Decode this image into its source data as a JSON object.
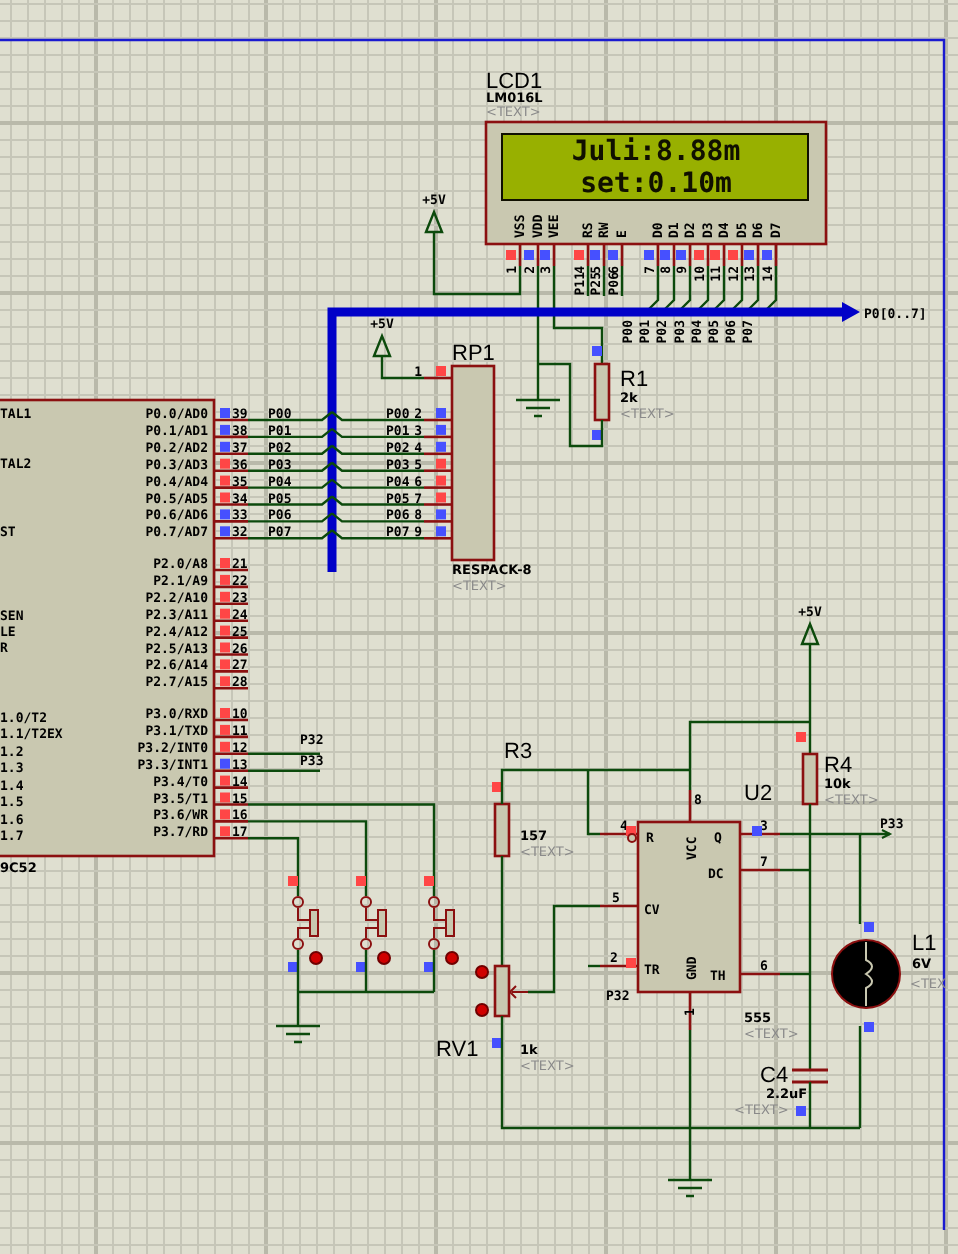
{
  "lcd": {
    "ref": "LCD1",
    "part": "LM016L",
    "text_tag": "<TEXT>",
    "lines": [
      "Juli:8.88m",
      "set:0.10m"
    ],
    "pins": [
      {
        "name": "VSS",
        "number": "1",
        "color": "#ff4646"
      },
      {
        "name": "VDD",
        "number": "2",
        "color": "#4650ff"
      },
      {
        "name": "VEE",
        "number": "3",
        "color": "#4650ff"
      },
      {
        "name": "RS",
        "number": "4",
        "color": "#ff4646"
      },
      {
        "name": "RW",
        "number": "5",
        "color": "#4650ff"
      },
      {
        "name": "E",
        "number": "6",
        "color": "#4650ff"
      },
      {
        "name": "D0",
        "number": "7",
        "color": "#4650ff"
      },
      {
        "name": "D1",
        "number": "8",
        "color": "#4650ff"
      },
      {
        "name": "D2",
        "number": "9",
        "color": "#4650ff"
      },
      {
        "name": "D3",
        "number": "10",
        "color": "#ff4646"
      },
      {
        "name": "D4",
        "number": "11",
        "color": "#ff4646"
      },
      {
        "name": "D5",
        "number": "12",
        "color": "#ff4646"
      },
      {
        "name": "D6",
        "number": "13",
        "color": "#4650ff"
      },
      {
        "name": "D7",
        "number": "14",
        "color": "#4650ff"
      }
    ],
    "net_labels": [
      "P11",
      "P25",
      "P06"
    ],
    "bus_taps": [
      "P00",
      "P01",
      "P02",
      "P03",
      "P04",
      "P05",
      "P06",
      "P07"
    ]
  },
  "power_labels": [
    "+5V",
    "+5V",
    "+5V"
  ],
  "bus": {
    "label": "P0[0..7]"
  },
  "mcu": {
    "part": "9C52",
    "left_pins": [
      "TAL1",
      "TAL2",
      "ST",
      "SEN",
      "LE",
      "R",
      "1.0/T2",
      "1.1/T2EX",
      "1.2",
      "1.3",
      "1.4",
      "1.5",
      "1.6",
      "1.7"
    ],
    "right_pins": [
      {
        "name": "P0.0/AD0",
        "number": "39",
        "color": "#4650ff"
      },
      {
        "name": "P0.1/AD1",
        "number": "38",
        "color": "#4650ff"
      },
      {
        "name": "P0.2/AD2",
        "number": "37",
        "color": "#4650ff"
      },
      {
        "name": "P0.3/AD3",
        "number": "36",
        "color": "#ff4646"
      },
      {
        "name": "P0.4/AD4",
        "number": "35",
        "color": "#ff4646"
      },
      {
        "name": "P0.5/AD5",
        "number": "34",
        "color": "#ff4646"
      },
      {
        "name": "P0.6/AD6",
        "number": "33",
        "color": "#4650ff"
      },
      {
        "name": "P0.7/AD7",
        "number": "32",
        "color": "#4650ff"
      },
      {
        "name": "P2.0/A8",
        "number": "21",
        "color": "#ff4646"
      },
      {
        "name": "P2.1/A9",
        "number": "22",
        "color": "#ff4646"
      },
      {
        "name": "P2.2/A10",
        "number": "23",
        "color": "#ff4646"
      },
      {
        "name": "P2.3/A11",
        "number": "24",
        "color": "#ff4646"
      },
      {
        "name": "P2.4/A12",
        "number": "25",
        "color": "#ff4646"
      },
      {
        "name": "P2.5/A13",
        "number": "26",
        "color": "#ff4646"
      },
      {
        "name": "P2.6/A14",
        "number": "27",
        "color": "#ff4646"
      },
      {
        "name": "P2.7/A15",
        "number": "28",
        "color": "#ff4646"
      },
      {
        "name": "P3.0/RXD",
        "number": "10",
        "color": "#ff4646"
      },
      {
        "name": "P3.1/TXD",
        "number": "11",
        "color": "#ff4646"
      },
      {
        "name": "P3.2/INT0",
        "number": "12",
        "color": "#ff4646"
      },
      {
        "name": "P3.3/INT1",
        "number": "13",
        "color": "#4650ff"
      },
      {
        "name": "P3.4/T0",
        "number": "14",
        "color": "#ff4646"
      },
      {
        "name": "P3.5/T1",
        "number": "15",
        "color": "#ff4646"
      },
      {
        "name": "P3.6/WR",
        "number": "16",
        "color": "#ff4646"
      },
      {
        "name": "P3.7/RD",
        "number": "17",
        "color": "#ff4646"
      }
    ],
    "port0_labels": [
      "P00",
      "P01",
      "P02",
      "P03",
      "P04",
      "P05",
      "P06",
      "P07"
    ],
    "net_labels": [
      "P32",
      "P33"
    ]
  },
  "rp1": {
    "ref": "RP1",
    "part": "RESPACK-8",
    "text_tag": "<TEXT>",
    "pins": [
      {
        "number": "1",
        "color": "#ff4646"
      },
      {
        "number": "2",
        "color": "#4650ff"
      },
      {
        "number": "3",
        "color": "#4650ff"
      },
      {
        "number": "4",
        "color": "#4650ff"
      },
      {
        "number": "5",
        "color": "#ff4646"
      },
      {
        "number": "6",
        "color": "#ff4646"
      },
      {
        "number": "7",
        "color": "#ff4646"
      },
      {
        "number": "8",
        "color": "#4650ff"
      },
      {
        "number": "9",
        "color": "#4650ff"
      }
    ],
    "net_labels": [
      "P00",
      "P01",
      "P02",
      "P03",
      "P04",
      "P05",
      "P06",
      "P07"
    ]
  },
  "r1": {
    "ref": "R1",
    "value": "2k",
    "text_tag": "<TEXT>",
    "pins": [
      {
        "color": "#4650ff"
      },
      {
        "color": "#4650ff"
      }
    ]
  },
  "buttons": [
    {
      "pins": [
        {
          "color": "#ff4646"
        },
        {
          "color": "#4650ff"
        }
      ]
    },
    {
      "pins": [
        {
          "color": "#ff4646"
        },
        {
          "color": "#4650ff"
        }
      ]
    },
    {
      "pins": [
        {
          "color": "#ff4646"
        },
        {
          "color": "#4650ff"
        }
      ]
    }
  ],
  "r3": {
    "ref": "R3",
    "value": "157",
    "text_tag": "<TEXT>",
    "pins": [
      {
        "color": "#ff4646"
      }
    ]
  },
  "rv1": {
    "ref": "RV1",
    "value": "1k",
    "text_tag": "<TEXT>",
    "pins": [
      {
        "color": "#4650ff"
      }
    ]
  },
  "u2": {
    "ref": "U2",
    "part": "555",
    "text_tag": "<TEXT>",
    "pins": [
      {
        "name": "R",
        "number": "4",
        "color": "#ff4646"
      },
      {
        "name": "VCC",
        "number": "8"
      },
      {
        "name": "Q",
        "number": "3",
        "color": "#4650ff"
      },
      {
        "name": "DC",
        "number": "7"
      },
      {
        "name": "CV",
        "number": "5"
      },
      {
        "name": "TR",
        "number": "2",
        "color": "#ff4646"
      },
      {
        "name": "GND",
        "number": "1"
      },
      {
        "name": "TH",
        "number": "6"
      }
    ],
    "net_labels": [
      "P32",
      "P33"
    ]
  },
  "r4": {
    "ref": "R4",
    "value": "10k",
    "text_tag": "<TEXT>",
    "pins": [
      {
        "color": "#ff4646"
      }
    ]
  },
  "c4": {
    "ref": "C4",
    "value": "2.2uF",
    "text_tag": "<TEXT>",
    "pins": [
      {
        "color": "#4650ff"
      }
    ]
  },
  "l1": {
    "ref": "L1",
    "value": "6V",
    "text_tag": "<TEX",
    "pins": [
      {
        "color": "#4650ff"
      },
      {
        "color": "#4650ff"
      }
    ]
  }
}
